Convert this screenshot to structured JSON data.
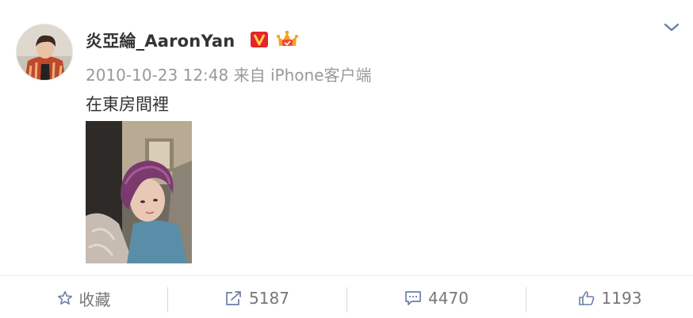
{
  "post": {
    "author_name": "炎亞綸_AaronYan",
    "timestamp": "2010-10-23 12:48",
    "source_prefix": "来自",
    "source": "iPhone客户端",
    "text": "在東房間裡",
    "badges": [
      "verified-v-badge",
      "crown-badge"
    ],
    "colors": {
      "verified": "#e5242b",
      "meta": "#999999",
      "text": "#333333"
    }
  },
  "actions": {
    "favorite_label": "收藏",
    "share_count": "5187",
    "comment_count": "4470",
    "like_count": "1193"
  },
  "icons": [
    "chevron-down-icon",
    "star-icon",
    "share-icon",
    "comment-icon",
    "thumbs-up-icon"
  ]
}
